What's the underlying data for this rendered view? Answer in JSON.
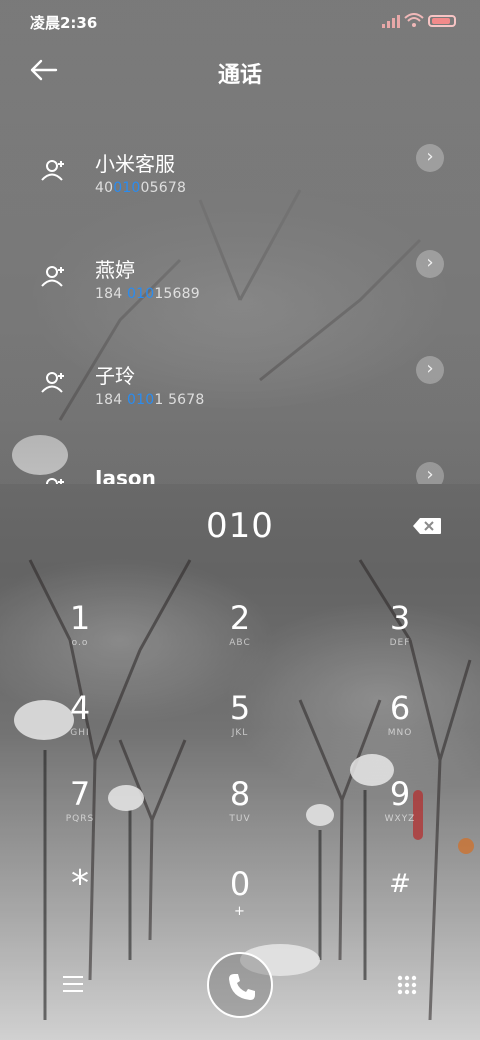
{
  "status_bar": {
    "time": "凌晨2:36"
  },
  "header": {
    "title": "通话"
  },
  "contacts": [
    {
      "name": "小米客服",
      "number_pre": "40",
      "number_match": "010",
      "number_post": "05678"
    },
    {
      "name": "燕婷",
      "number_pre": "184 ",
      "number_match": "010",
      "number_post": "15689"
    },
    {
      "name": "子玲",
      "number_pre": "184 ",
      "number_match": "010",
      "number_post": "1 5678"
    },
    {
      "name": "Jason",
      "number_pre": "",
      "number_match": "",
      "number_post": ""
    }
  ],
  "dialer": {
    "input": "010",
    "keys": [
      {
        "digit": "1",
        "letters": "o.o"
      },
      {
        "digit": "2",
        "letters": "ABC"
      },
      {
        "digit": "3",
        "letters": "DEF"
      },
      {
        "digit": "4",
        "letters": "GHI"
      },
      {
        "digit": "5",
        "letters": "JKL"
      },
      {
        "digit": "6",
        "letters": "MNO"
      },
      {
        "digit": "7",
        "letters": "PQRS"
      },
      {
        "digit": "8",
        "letters": "TUV"
      },
      {
        "digit": "9",
        "letters": "WXYZ"
      },
      {
        "digit": "*",
        "letters": ""
      },
      {
        "digit": "0",
        "letters": "+"
      },
      {
        "digit": "#",
        "letters": ""
      }
    ]
  },
  "icons": {
    "status": [
      "signal-icon",
      "wifi-icon",
      "battery-icon"
    ],
    "header": "back-arrow-icon",
    "contact": "contact-person-icon",
    "row_action": "chevron-right-icon",
    "dialer": [
      "backspace-icon",
      "menu-icon",
      "phone-icon",
      "keypad-grid-icon"
    ]
  },
  "colors": {
    "match_highlight": "#2a8cf0",
    "text": "#ffffff"
  }
}
